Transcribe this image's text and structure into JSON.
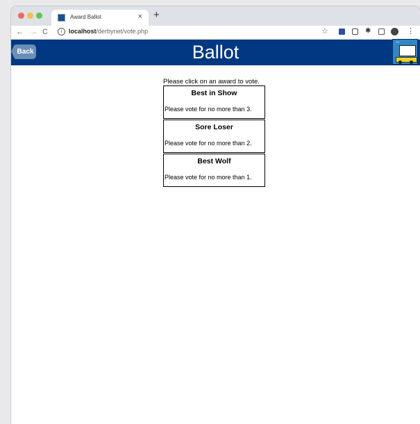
{
  "browser": {
    "tab_title": "Award Ballot",
    "tab_close": "×",
    "new_tab": "+",
    "url_host": "localhost",
    "url_path": "/derbynet/vote.php"
  },
  "banner": {
    "back_label": "Back",
    "title": "Ballot",
    "background_color": "#023882"
  },
  "ballot": {
    "instructions": "Please click on an award to vote.",
    "awards": [
      {
        "name": "Best in Show",
        "limit_text": "Please vote for no more than 3."
      },
      {
        "name": "Sore Loser",
        "limit_text": "Please vote for no more than 2."
      },
      {
        "name": "Best Wolf",
        "limit_text": "Please vote for no more than 1."
      }
    ]
  }
}
